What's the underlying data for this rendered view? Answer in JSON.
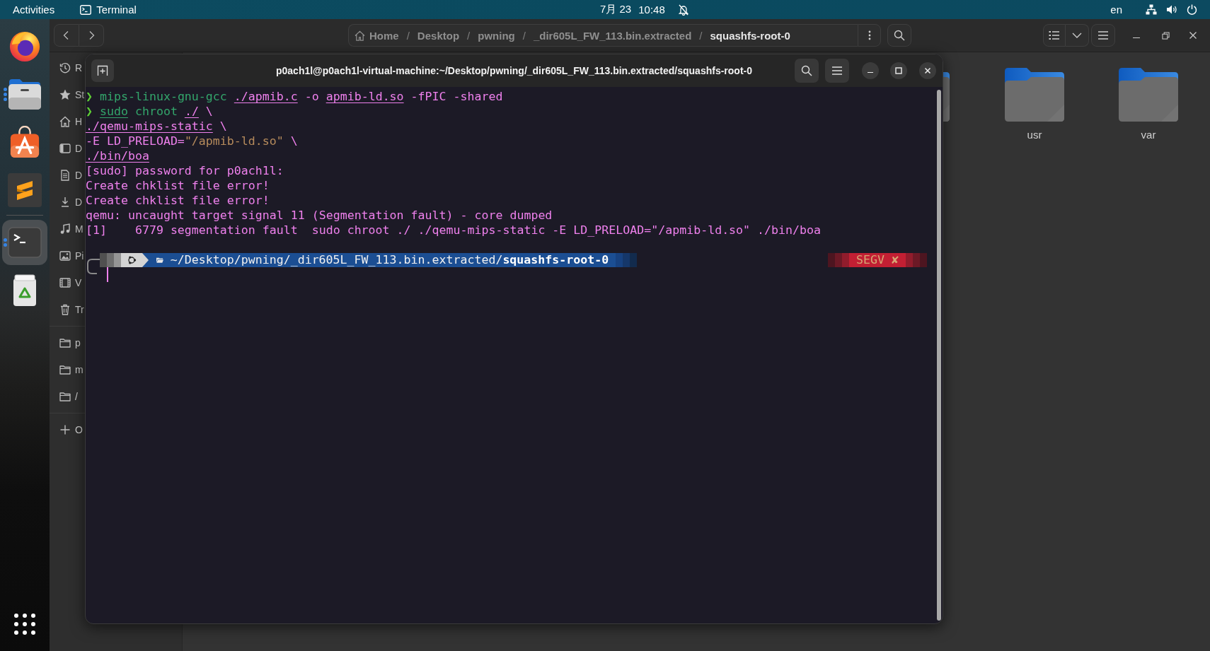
{
  "top_bar": {
    "activities": "Activities",
    "app_menu": "Terminal",
    "date": "7月 23",
    "time": "10:48",
    "do_not_disturb": true,
    "input_source": "en"
  },
  "dock": {
    "favorites": [
      {
        "kind": "browser",
        "selected": false
      },
      {
        "kind": "files",
        "windows": [
          {
            "kind": "window"
          },
          {
            "kind": "window"
          },
          {
            "kind": "window"
          }
        ],
        "selected": false
      },
      {
        "kind": "software",
        "selected": false
      },
      {
        "kind": "editor",
        "selected": false
      }
    ],
    "others": [
      {
        "kind": "terminal",
        "windows": [
          {
            "kind": "window"
          },
          {
            "kind": "window"
          }
        ],
        "selected": true
      },
      {
        "kind": "trash",
        "selected": false
      }
    ]
  },
  "file_manager": {
    "path": [
      {
        "kind": "home",
        "label": "Home",
        "current": false
      },
      {
        "separator": "/",
        "label": "Desktop",
        "current": false
      },
      {
        "separator": "/",
        "label": "pwning",
        "current": false
      },
      {
        "separator": "/",
        "label": "_dir605L_FW_113.bin.extracted",
        "current": false
      },
      {
        "separator": "/",
        "label": "squashfs-root-0",
        "current": true
      }
    ],
    "sidebar": {
      "places": [
        {
          "kind": "recent",
          "label": "R"
        },
        {
          "kind": "starred",
          "label": "St"
        },
        {
          "kind": "home",
          "label": "H"
        },
        {
          "kind": "desktop",
          "label": "D"
        },
        {
          "kind": "documents",
          "label": "D"
        },
        {
          "kind": "downloads",
          "label": "D"
        },
        {
          "kind": "music",
          "label": "M"
        },
        {
          "kind": "pictures",
          "label": "Pi"
        },
        {
          "kind": "videos",
          "label": "V"
        },
        {
          "kind": "trash",
          "label": "Tr"
        }
      ],
      "bookmarks": [
        {
          "kind": "folder",
          "label": "p"
        },
        {
          "kind": "folder",
          "label": "m"
        },
        {
          "kind": "folder",
          "label": "/"
        }
      ],
      "other": [
        {
          "kind": "add",
          "label": "O"
        }
      ]
    },
    "items": [
      {
        "kind": "folder_partial"
      },
      {
        "kind": "folder",
        "name": "usr"
      },
      {
        "kind": "folder",
        "name": "var"
      }
    ]
  },
  "terminal": {
    "title": "p0ach1l@p0ach1l-virtual-machine:~/Desktop/pwning/_dir605L_FW_113.bin.extracted/squashfs-root-0",
    "lines": [
      {
        "kind": "command",
        "tokens": [
          {
            "text": "❯ ",
            "kind": "prompt"
          },
          {
            "text": "mips-linux-gnu-gcc ",
            "kind": "command"
          },
          {
            "text": "./apmib.c",
            "kind": "path"
          },
          {
            "text": " -o ",
            "kind": "arg"
          },
          {
            "text": "apmib-ld.so",
            "kind": "path"
          },
          {
            "text": " -fPIC -shared",
            "kind": "arg"
          }
        ]
      },
      {
        "kind": "command",
        "tokens": [
          {
            "text": "❯ ",
            "kind": "prompt"
          },
          {
            "text": "sudo",
            "kind": "command_path"
          },
          {
            "text": " chroot ",
            "kind": "command"
          },
          {
            "text": "./",
            "kind": "path"
          },
          {
            "text": " \\",
            "kind": "arg"
          }
        ]
      },
      {
        "kind": "continuation",
        "tokens": [
          {
            "text": "./qemu-mips-static",
            "kind": "path"
          },
          {
            "text": " \\",
            "kind": "arg"
          }
        ]
      },
      {
        "kind": "continuation",
        "tokens": [
          {
            "text": "-E LD_PRELOAD=",
            "kind": "arg"
          },
          {
            "text": "\"/apmib-ld.so\"",
            "kind": "string"
          },
          {
            "text": " \\",
            "kind": "arg"
          }
        ]
      },
      {
        "kind": "continuation",
        "tokens": [
          {
            "text": "./bin/boa",
            "kind": "path"
          }
        ]
      },
      {
        "kind": "output",
        "text": "[sudo] password for p0ach1l:"
      },
      {
        "kind": "output",
        "text": "Create chklist file error!"
      },
      {
        "kind": "output",
        "text": "Create chklist file error!"
      },
      {
        "kind": "output",
        "text": "qemu: uncaught target signal 11 (Segmentation fault) - core dumped"
      },
      {
        "kind": "output",
        "text": "[1]    6779 segmentation fault  sudo chroot ./ ./qemu-mips-static -E LD_PRELOAD=\"/apmib-ld.so\" ./bin/boa"
      }
    ],
    "prompt": {
      "directory": "~/Desktop/pwning/_dir605L_FW_113.bin.extracted/**squashfs-root-0**",
      "status": "SEGV ✘"
    }
  }
}
